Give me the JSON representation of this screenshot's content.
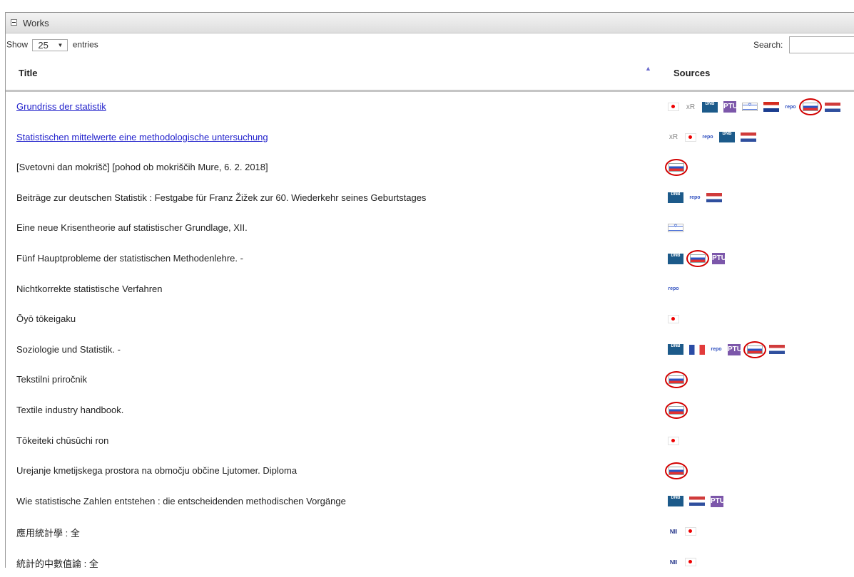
{
  "panel": {
    "title": "Works"
  },
  "length_menu": {
    "prefix": "Show",
    "value": "25",
    "suffix": "entries"
  },
  "search": {
    "label": "Search:",
    "value": ""
  },
  "columns": {
    "title": "Title",
    "sources": "Sources"
  },
  "rows": [
    {
      "title": "Grundriss der statistik",
      "link": true,
      "sources": [
        "jp-flag",
        "xr",
        "dnb",
        "ptu",
        "il-flag",
        "hr-flag",
        "repo",
        {
          "icon": "si-flag",
          "circled": true
        },
        "nl-flag"
      ]
    },
    {
      "title": "Statistischen mittelwerte eine methodologische untersuchung",
      "link": true,
      "sources": [
        "xr",
        "jp-flag",
        "repo",
        "dnb",
        "nl-flag"
      ]
    },
    {
      "title": "[Svetovni dan mokrišč] [pohod ob mokriščih Mure, 6. 2. 2018]",
      "link": false,
      "sources": [
        {
          "icon": "si-flag",
          "circled": true
        }
      ]
    },
    {
      "title": "Beiträge zur deutschen Statistik : Festgabe für Franz Žižek zur 60. Wiederkehr seines Geburtstages",
      "link": false,
      "sources": [
        "dnb",
        "repo",
        "nl-flag"
      ]
    },
    {
      "title": "Eine neue Krisentheorie auf statistischer Grundlage, XII.",
      "link": false,
      "sources": [
        "il-flag"
      ]
    },
    {
      "title": "Fünf Hauptprobleme der statistischen Methodenlehre. -",
      "link": false,
      "sources": [
        "dnb",
        {
          "icon": "si-flag",
          "circled": true
        },
        "ptu"
      ]
    },
    {
      "title": "Nichtkorrekte statistische Verfahren",
      "link": false,
      "sources": [
        "repo"
      ]
    },
    {
      "title": "Ōyō tōkeigaku",
      "link": false,
      "sources": [
        "jp-flag"
      ]
    },
    {
      "title": "Soziologie und Statistik. -",
      "link": false,
      "sources": [
        "dnb",
        "fr-flag",
        "repo",
        "ptu",
        {
          "icon": "si-flag",
          "circled": true
        },
        "nl-flag"
      ]
    },
    {
      "title": "Tekstilni priročnik",
      "link": false,
      "sources": [
        {
          "icon": "si-flag",
          "circled": true
        }
      ]
    },
    {
      "title": "Textile industry handbook.",
      "link": false,
      "sources": [
        {
          "icon": "si-flag",
          "circled": true
        }
      ]
    },
    {
      "title": "Tōkeiteki chūsūchi ron",
      "link": false,
      "sources": [
        "jp-flag"
      ]
    },
    {
      "title": "Urejanje kmetijskega prostora na območju občine Ljutomer. Diploma",
      "link": false,
      "sources": [
        {
          "icon": "si-flag",
          "circled": true
        }
      ]
    },
    {
      "title": "Wie statistische Zahlen entstehen : die entscheidenden methodischen Vorgänge",
      "link": false,
      "sources": [
        "dnb",
        "nl-flag",
        "ptu"
      ]
    },
    {
      "title": "應用統計學 : 全",
      "link": false,
      "sources": [
        "nii",
        "jp-flag"
      ]
    },
    {
      "title": "統計的中數值論 : 全",
      "link": false,
      "sources": [
        "nii",
        "jp-flag"
      ]
    }
  ],
  "icon_text": {
    "xr": "xR",
    "dnb": "DNB",
    "ptu": "PTU",
    "repo": "repo",
    "nii": "NII"
  },
  "highlight_color": "#d20000",
  "link_color": "#2222cc"
}
